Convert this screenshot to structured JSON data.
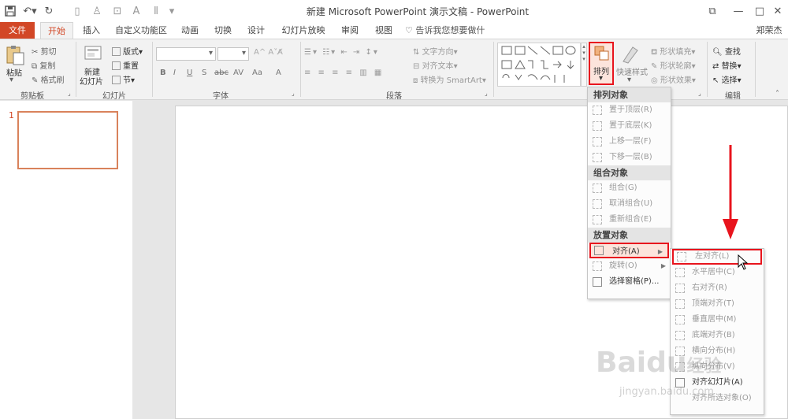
{
  "app_title": "新建 Microsoft PowerPoint 演示文稿 - PowerPoint",
  "user": "郑荣杰",
  "tabs": [
    "文件",
    "开始",
    "插入",
    "自定义功能区",
    "动画",
    "切换",
    "设计",
    "幻灯片放映",
    "审阅",
    "视图"
  ],
  "tell_me": "告诉我您想要做什么...",
  "clipboard": {
    "paste": "粘贴",
    "cut": "剪切",
    "copy": "复制",
    "format_painter": "格式刷",
    "label": "剪贴板"
  },
  "slides_group": {
    "new_slide_1": "新建",
    "new_slide_2": "幻灯片",
    "layout": "版式",
    "reset": "重置",
    "section": "节",
    "label": "幻灯片"
  },
  "font_group": {
    "label": "字体",
    "buttons": [
      "B",
      "I",
      "U",
      "S",
      "abc",
      "AV",
      "Aa",
      "A"
    ]
  },
  "paragraph_group": {
    "text_direction": "文字方向",
    "align_text": "对齐文本",
    "smartart": "转换为 SmartArt",
    "label": "段落"
  },
  "drawing_group": {
    "arrange": "排列",
    "quick_styles": "快速样式",
    "shape_fill": "形状填充",
    "shape_outline": "形状轮廓",
    "shape_effects": "形状效果"
  },
  "editing_group": {
    "find": "查找",
    "replace": "替换",
    "select": "选择",
    "label": "编辑"
  },
  "slide_number": "1",
  "arrange_menu": {
    "h1": "排列对象",
    "order": [
      "置于顶层(R)",
      "置于底层(K)",
      "上移一层(F)",
      "下移一层(B)"
    ],
    "h2": "组合对象",
    "group": [
      "组合(G)",
      "取消组合(U)",
      "重新组合(E)"
    ],
    "h3": "放置对象",
    "place": [
      "对齐(A)",
      "旋转(O)",
      "选择窗格(P)..."
    ]
  },
  "align_menu": {
    "items": [
      "左对齐(L)",
      "水平居中(C)",
      "右对齐(R)",
      "顶端对齐(T)",
      "垂直居中(M)",
      "底端对齐(B)",
      "横向分布(H)",
      "纵向分布(V)",
      "对齐幻灯片(A)",
      "对齐所选对象(O)"
    ]
  },
  "watermark": {
    "brand": "Baidu",
    "sub": "经验",
    "url": "jingyan.baidu.com"
  },
  "colors": {
    "accent": "#d24726",
    "highlight": "#fce4dc",
    "red_arrow": "#e8141d"
  }
}
